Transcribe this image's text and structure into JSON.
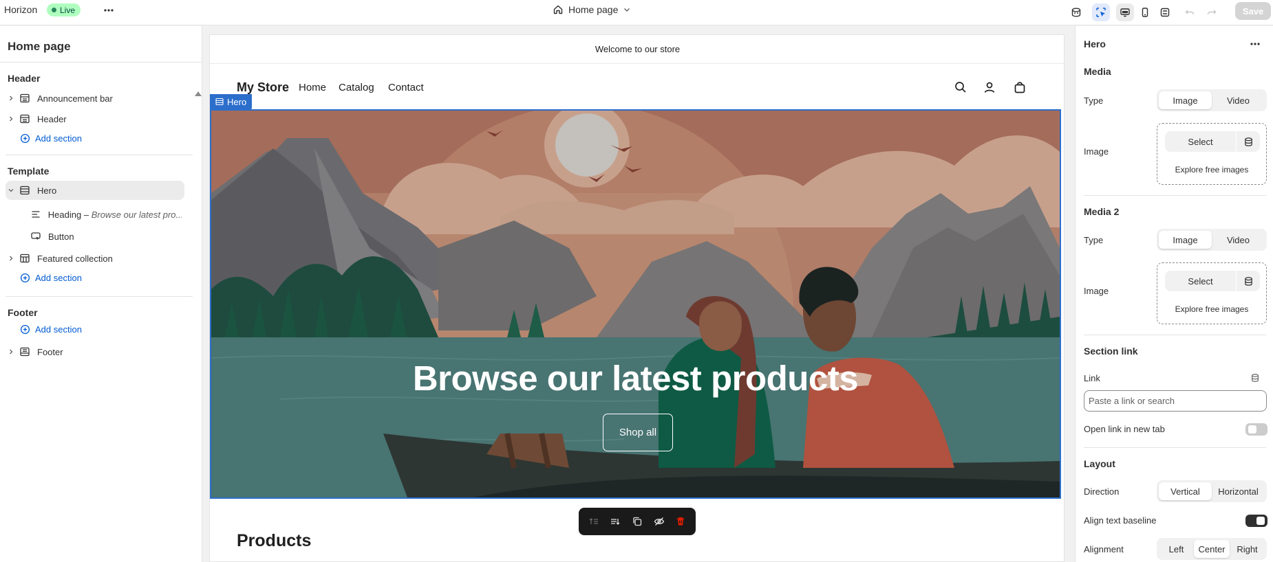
{
  "topbar": {
    "app_name": "Horizon",
    "status_badge": "Live",
    "page_selector": "Home page",
    "save_label": "Save"
  },
  "left_sidebar": {
    "title": "Home page",
    "header_group": {
      "title": "Header",
      "items": [
        {
          "label": "Announcement bar"
        },
        {
          "label": "Header"
        }
      ],
      "add_section": "Add section"
    },
    "template_group": {
      "title": "Template",
      "hero": {
        "label": "Hero"
      },
      "hero_children": [
        {
          "label": "Heading",
          "detail": "Browse our latest pro..."
        },
        {
          "label": "Button"
        }
      ],
      "featured": {
        "label": "Featured collection"
      },
      "add_section": "Add section"
    },
    "footer_group": {
      "title": "Footer",
      "add_section": "Add section",
      "items": [
        {
          "label": "Footer"
        }
      ]
    }
  },
  "preview": {
    "announcement": "Welcome to our store",
    "store_name": "My Store",
    "nav": [
      "Home",
      "Catalog",
      "Contact"
    ],
    "hero_tag": "Hero",
    "hero_heading": "Browse our latest products",
    "hero_button": "Shop all",
    "products_heading": "Products"
  },
  "settings": {
    "section_title": "Hero",
    "media": {
      "heading": "Media",
      "type_label": "Type",
      "type_options": [
        "Image",
        "Video"
      ],
      "type_selected": "Image",
      "image_label": "Image",
      "select_label": "Select",
      "explore_label": "Explore free images"
    },
    "media2": {
      "heading": "Media 2",
      "type_label": "Type",
      "type_options": [
        "Image",
        "Video"
      ],
      "type_selected": "Image",
      "image_label": "Image",
      "select_label": "Select",
      "explore_label": "Explore free images"
    },
    "section_link": {
      "heading": "Section link",
      "link_label": "Link",
      "link_placeholder": "Paste a link or search",
      "new_tab_label": "Open link in new tab",
      "new_tab_on": false
    },
    "layout": {
      "heading": "Layout",
      "direction_label": "Direction",
      "direction_options": [
        "Vertical",
        "Horizontal"
      ],
      "direction_selected": "Vertical",
      "align_baseline_label": "Align text baseline",
      "align_baseline_on": true,
      "alignment_label": "Alignment",
      "alignment_options": [
        "Left",
        "Center",
        "Right"
      ],
      "alignment_selected": "Center"
    }
  },
  "colors": {
    "accent_blue": "#2c6ecb",
    "link_blue": "#005bd3",
    "live_badge_bg": "#affebf",
    "delete_red": "#e51c00"
  },
  "icons": {
    "topbar_right": [
      "theme-settings-icon",
      "inspector-icon",
      "desktop-icon",
      "mobile-icon",
      "fullscreen-icon",
      "undo-icon",
      "redo-icon"
    ],
    "preview_header": [
      "search-icon",
      "account-icon",
      "cart-icon"
    ],
    "floating_toolbar": [
      "move-up-icon",
      "move-down-icon",
      "duplicate-icon",
      "hide-icon",
      "delete-icon"
    ]
  }
}
